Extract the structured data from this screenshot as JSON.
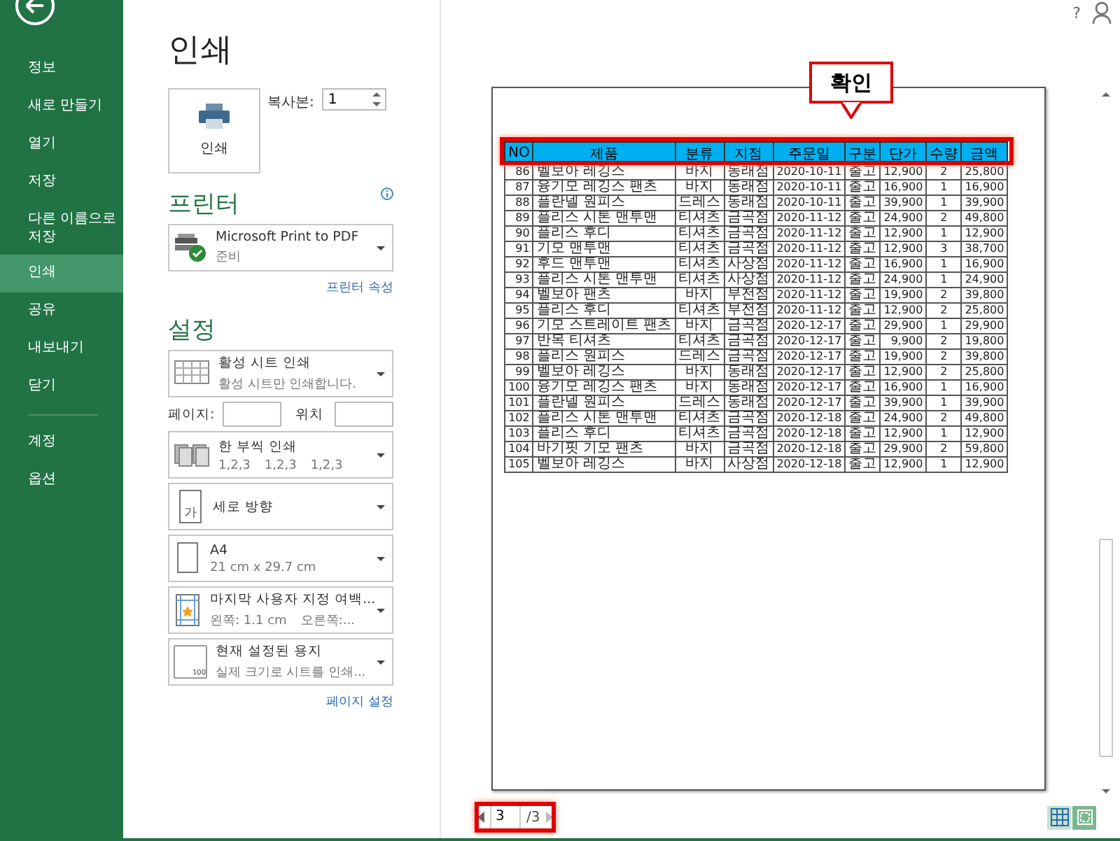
{
  "sidebar": {
    "items": [
      {
        "label": "정보",
        "selected": false
      },
      {
        "label": "새로 만들기",
        "selected": false
      },
      {
        "label": "열기",
        "selected": false
      },
      {
        "label": "저장",
        "selected": false
      },
      {
        "label": "다른 이름으로 저장",
        "selected": false
      },
      {
        "label": "인쇄",
        "selected": true
      },
      {
        "label": "공유",
        "selected": false
      },
      {
        "label": "내보내기",
        "selected": false
      },
      {
        "label": "닫기",
        "selected": false
      }
    ],
    "footer_items": [
      {
        "label": "계정",
        "selected": false
      },
      {
        "label": "옵션",
        "selected": false
      }
    ]
  },
  "help": "?",
  "title": "인쇄",
  "print_button": "인쇄",
  "copies": {
    "label": "복사본:",
    "value": "1"
  },
  "printer": {
    "heading": "프린터",
    "name": "Microsoft Print to PDF",
    "status": "준비",
    "link": "프린터 속성"
  },
  "settings": {
    "heading": "설정",
    "options": [
      {
        "kind": "sheet",
        "title": "활성 시트 인쇄",
        "subtitle": "활성 시트만 인쇄합니다."
      },
      {
        "kind": "pages",
        "label": "페이지:",
        "to_label": "위치"
      },
      {
        "kind": "collate",
        "title": "한 부씩 인쇄",
        "subtitle_parts": [
          "1,2,3",
          "1,2,3",
          "1,2,3"
        ]
      },
      {
        "kind": "orientation",
        "title": "세로 방향",
        "icon_text": "가"
      },
      {
        "kind": "paper",
        "title": "A4",
        "subtitle": "21 cm x 29.7 cm"
      },
      {
        "kind": "margins",
        "title": "마지막 사용자 지정 여백...",
        "subtitle_parts": [
          "왼쪽:  1.1 cm",
          "오른쪽:..."
        ]
      },
      {
        "kind": "scaling",
        "title": "현재 설정된 용지",
        "subtitle": "실제 크기로 시트를 인쇄...",
        "icon_text": "100"
      }
    ],
    "link": "페이지 설정"
  },
  "preview": {
    "columns": [
      "NO",
      "제품",
      "분류",
      "지점",
      "주문일",
      "구분",
      "단가",
      "수량",
      "금액"
    ],
    "rows": [
      [
        "86",
        "벨보아 레깅스",
        "바지",
        "동래점",
        "2020-10-11",
        "출고",
        "12,900",
        "2",
        "25,800"
      ],
      [
        "87",
        "융기모 레깅스 팬츠",
        "바지",
        "동래점",
        "2020-10-11",
        "출고",
        "16,900",
        "1",
        "16,900"
      ],
      [
        "88",
        "플란넬 원피스",
        "드레스",
        "동래점",
        "2020-10-11",
        "출고",
        "39,900",
        "1",
        "39,900"
      ],
      [
        "89",
        "플리스 시톤 맨투맨",
        "티셔츠",
        "금곡점",
        "2020-11-12",
        "출고",
        "24,900",
        "2",
        "49,800"
      ],
      [
        "90",
        "플리스 후디",
        "티셔츠",
        "금곡점",
        "2020-11-12",
        "출고",
        "12,900",
        "1",
        "12,900"
      ],
      [
        "91",
        "기모 맨투맨",
        "티셔츠",
        "금곡점",
        "2020-11-12",
        "출고",
        "12,900",
        "3",
        "38,700"
      ],
      [
        "92",
        "후드 맨투맨",
        "티셔츠",
        "사상점",
        "2020-11-12",
        "출고",
        "16,900",
        "1",
        "16,900"
      ],
      [
        "93",
        "플리스 시톤 맨투맨",
        "티셔츠",
        "사상점",
        "2020-11-12",
        "출고",
        "24,900",
        "1",
        "24,900"
      ],
      [
        "94",
        "벨보아 팬츠",
        "바지",
        "부전점",
        "2020-11-12",
        "출고",
        "19,900",
        "2",
        "39,800"
      ],
      [
        "95",
        "플리스 후디",
        "티셔츠",
        "부전점",
        "2020-11-12",
        "출고",
        "12,900",
        "2",
        "25,800"
      ],
      [
        "96",
        "기모 스트레이트 팬츠",
        "바지",
        "금곡점",
        "2020-12-17",
        "출고",
        "29,900",
        "1",
        "29,900"
      ],
      [
        "97",
        "반목 티셔츠",
        "티셔츠",
        "금곡점",
        "2020-12-17",
        "출고",
        "9,900",
        "2",
        "19,800"
      ],
      [
        "98",
        "플리스 원피스",
        "드레스",
        "금곡점",
        "2020-12-17",
        "출고",
        "19,900",
        "2",
        "39,800"
      ],
      [
        "99",
        "벨보아 레깅스",
        "바지",
        "동래점",
        "2020-12-17",
        "출고",
        "12,900",
        "2",
        "25,800"
      ],
      [
        "100",
        "융기모 레깅스 팬츠",
        "바지",
        "동래점",
        "2020-12-17",
        "출고",
        "16,900",
        "1",
        "16,900"
      ],
      [
        "101",
        "플란넬 원피스",
        "드레스",
        "동래점",
        "2020-12-17",
        "출고",
        "39,900",
        "1",
        "39,900"
      ],
      [
        "102",
        "플리스 시톤 맨투맨",
        "티셔츠",
        "금곡점",
        "2020-12-18",
        "출고",
        "24,900",
        "2",
        "49,800"
      ],
      [
        "103",
        "플리스 후디",
        "티셔츠",
        "금곡점",
        "2020-12-18",
        "출고",
        "12,900",
        "1",
        "12,900"
      ],
      [
        "104",
        "바기핏 기모 팬츠",
        "바지",
        "금곡점",
        "2020-12-18",
        "출고",
        "29,900",
        "2",
        "59,800"
      ],
      [
        "105",
        "벨보아 레깅스",
        "바지",
        "사상점",
        "2020-12-18",
        "출고",
        "12,900",
        "1",
        "12,900"
      ]
    ]
  },
  "pager": {
    "page": "3",
    "total": "/3"
  },
  "view_buttons": [
    {
      "kind": "margins",
      "selected": false
    },
    {
      "kind": "zoom",
      "selected": true
    }
  ],
  "annotations": {
    "callout": "확인",
    "highlight_header": true,
    "highlight_pager": true
  }
}
